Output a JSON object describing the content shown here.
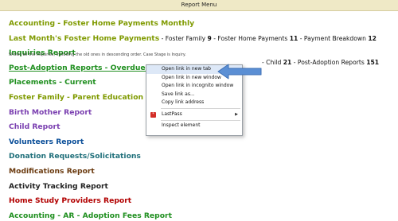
{
  "header": {
    "title": "Report Menu"
  },
  "menu": {
    "accounting_foster": "Accounting - Foster Home Payments Monthly",
    "last_month": {
      "label": "Last Month's Foster Home Payments",
      "sep": " - ",
      "ff_label": "Foster Family",
      "ff_value": "9",
      "fhp_label": "Foster Home Payments",
      "fhp_value": "11",
      "pb_label": "Payment Breakdown",
      "pb_value": "12"
    },
    "inquiries": {
      "label": "Inquiries Report",
      "note": "Shows all the Inquiries, including the old ones in descending order. Case Stage is Inquiry."
    },
    "post_adoption": {
      "label": "Post-Adoption Reports - Overdue and Upcoming",
      "tail_sep": " - ",
      "child_label": "Child",
      "child_value": "21",
      "par_label": "Post-Adoption Reports",
      "par_value": "151"
    },
    "placements": "Placements - Current",
    "foster_family_edu": "Foster Family - Parent Education",
    "birth_mother": "Birth Mother Report",
    "child_report": "Child Report",
    "volunteers": "Volunteers Report",
    "donations": "Donation Requests/Solicitations",
    "modifications": "Modifications Report",
    "activity": "Activity Tracking Report",
    "home_study": "Home Study Providers Report",
    "accounting_ar": "Accounting - AR - Adoption Fees Report"
  },
  "context_menu": {
    "open_new_tab": "Open link in new tab",
    "open_new_window": "Open link in new window",
    "open_incognito": "Open link in incognito window",
    "save_link": "Save link as...",
    "copy_link": "Copy link address",
    "lastpass": "LastPass",
    "lastpass_icon_char": "*",
    "submenu_arrow": "▶",
    "inspect": "Inspect element"
  },
  "colors": {
    "header_bg": "#efe9c6",
    "highlight": "#dde8f7",
    "callout_arrow": "#5b8fd4"
  }
}
